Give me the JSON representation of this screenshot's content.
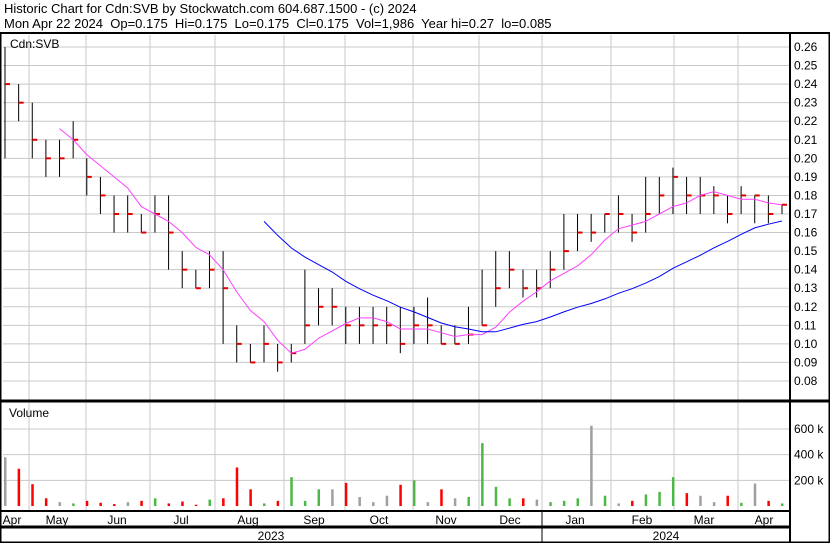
{
  "header": {
    "title": "Historic Chart for Cdn:SVB by Stockwatch.com 604.687.1500 - (c) 2024",
    "quote": "Mon Apr 22 2024  Op=0.175  Hi=0.175  Lo=0.175  Cl=0.175  Vol=1,986  Year hi=0.27  lo=0.085"
  },
  "chart_data": {
    "type": "ohlc",
    "symbol": "Cdn:SVB",
    "volume_label": "Volume",
    "price_ticks": [
      "0.26",
      "0.25",
      "0.24",
      "0.23",
      "0.22",
      "0.21",
      "0.20",
      "0.19",
      "0.18",
      "0.17",
      "0.16",
      "0.15",
      "0.14",
      "0.13",
      "0.12",
      "0.11",
      "0.10",
      "0.09",
      "0.08"
    ],
    "volume_ticks": [
      "600 k",
      "400 k",
      "200 k"
    ],
    "months": [
      "Apr",
      "May",
      "Jun",
      "Jul",
      "Aug",
      "Sep",
      "Oct",
      "Nov",
      "Dec",
      "Jan",
      "Feb",
      "Mar",
      "Apr"
    ],
    "years": [
      "2023",
      "2024"
    ],
    "ylim": [
      0.07,
      0.265
    ],
    "colors": {
      "up": "#4db848",
      "down": "#ff0000",
      "flat": "#a0a0a0",
      "ma_short": "#ff40ff",
      "ma_long": "#0000ff"
    },
    "weekly": {
      "close": [
        0.24,
        0.23,
        0.21,
        0.2,
        0.2,
        0.21,
        0.19,
        0.18,
        0.17,
        0.17,
        0.16,
        0.17,
        0.16,
        0.14,
        0.13,
        0.14,
        0.13,
        0.1,
        0.09,
        0.1,
        0.09,
        0.095,
        0.11,
        0.12,
        0.12,
        0.11,
        0.11,
        0.11,
        0.11,
        0.1,
        0.11,
        0.11,
        0.1,
        0.1,
        0.105,
        0.11,
        0.13,
        0.14,
        0.13,
        0.13,
        0.14,
        0.15,
        0.16,
        0.16,
        0.17,
        0.17,
        0.16,
        0.17,
        0.18,
        0.19,
        0.18,
        0.18,
        0.18,
        0.17,
        0.18,
        0.18,
        0.17,
        0.175
      ],
      "high": [
        0.26,
        0.24,
        0.23,
        0.21,
        0.21,
        0.22,
        0.2,
        0.19,
        0.18,
        0.18,
        0.17,
        0.18,
        0.18,
        0.15,
        0.14,
        0.15,
        0.15,
        0.11,
        0.1,
        0.11,
        0.1,
        0.1,
        0.14,
        0.13,
        0.13,
        0.12,
        0.12,
        0.12,
        0.12,
        0.12,
        0.12,
        0.125,
        0.11,
        0.11,
        0.12,
        0.14,
        0.15,
        0.15,
        0.14,
        0.14,
        0.15,
        0.17,
        0.17,
        0.17,
        0.17,
        0.18,
        0.17,
        0.19,
        0.19,
        0.195,
        0.19,
        0.19,
        0.185,
        0.18,
        0.185,
        0.18,
        0.18,
        0.175
      ],
      "low": [
        0.2,
        0.22,
        0.2,
        0.19,
        0.19,
        0.2,
        0.18,
        0.17,
        0.16,
        0.16,
        0.16,
        0.16,
        0.14,
        0.13,
        0.13,
        0.13,
        0.1,
        0.09,
        0.09,
        0.09,
        0.085,
        0.09,
        0.1,
        0.11,
        0.11,
        0.1,
        0.1,
        0.1,
        0.1,
        0.095,
        0.1,
        0.1,
        0.1,
        0.1,
        0.1,
        0.11,
        0.12,
        0.13,
        0.125,
        0.125,
        0.13,
        0.14,
        0.15,
        0.155,
        0.16,
        0.16,
        0.155,
        0.16,
        0.17,
        0.17,
        0.17,
        0.17,
        0.17,
        0.165,
        0.17,
        0.165,
        0.165,
        0.17
      ],
      "volume_k": [
        380,
        290,
        170,
        60,
        30,
        20,
        40,
        25,
        15,
        30,
        40,
        60,
        20,
        35,
        10,
        50,
        60,
        300,
        130,
        20,
        40,
        225,
        40,
        130,
        130,
        180,
        70,
        30,
        80,
        165,
        200,
        30,
        130,
        60,
        70,
        490,
        150,
        60,
        60,
        50,
        30,
        40,
        60,
        625,
        80,
        20,
        40,
        90,
        110,
        225,
        100,
        80,
        30,
        80,
        25,
        175,
        40,
        20
      ]
    }
  }
}
